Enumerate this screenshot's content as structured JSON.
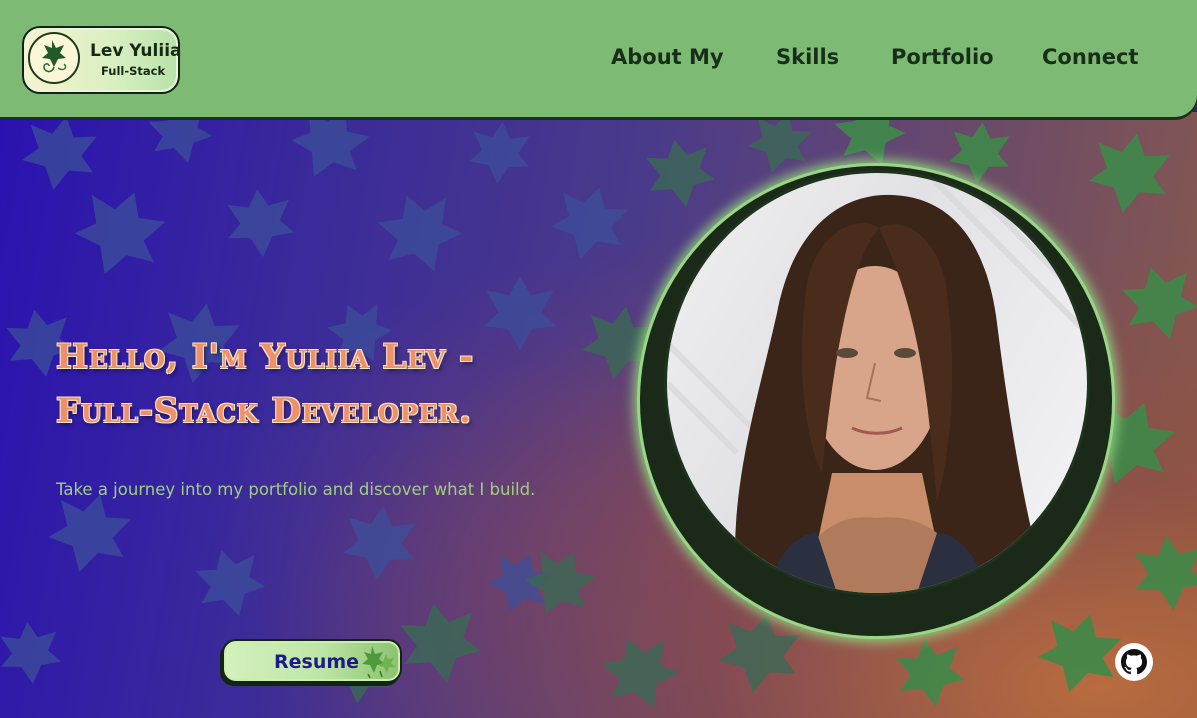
{
  "brand": {
    "name": "Lev Yuliia",
    "tagline": "Full-Stack",
    "icon": "ivy-leaf-logo-icon"
  },
  "nav": {
    "items": [
      {
        "label": "About My"
      },
      {
        "label": "Skills"
      },
      {
        "label": "Portfolio"
      },
      {
        "label": "Connect"
      }
    ]
  },
  "hero": {
    "title_line1": "Hello, I'm Yuliia Lev -",
    "title_line2": "Full-Stack Developer.",
    "subtitle": "Take a journey into my portfolio and discover what I build.",
    "resume_label": "Resume",
    "resume_icon": "ivy-leaf-icon",
    "photo_alt": "Portrait of Yuliia Lev"
  },
  "social": {
    "github_icon": "github-icon"
  },
  "colors": {
    "header_bg": "#7dbb74",
    "title": "#f0906a",
    "subtitle": "#9fcf7a",
    "resume_text": "#1e1a8a",
    "nav_text": "#182e18"
  }
}
